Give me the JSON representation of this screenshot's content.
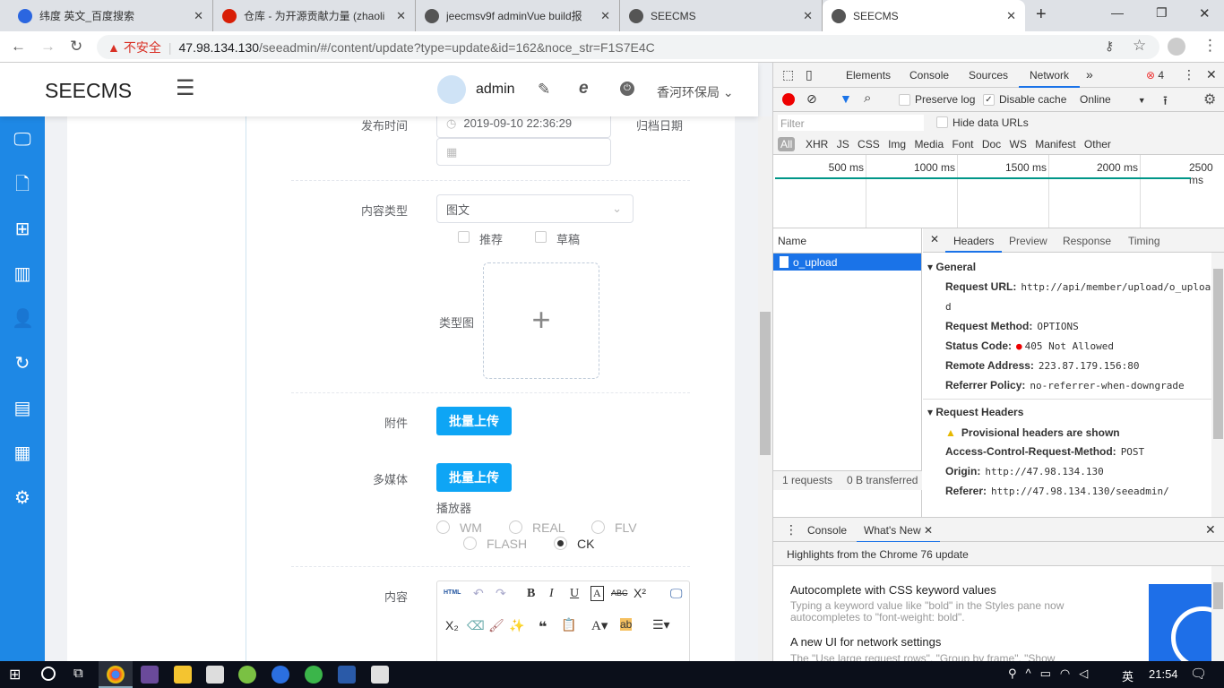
{
  "browser": {
    "tabs": [
      {
        "title": "纬度 英文_百度搜索"
      },
      {
        "title": "仓库 - 为开源贡献力量 (zhaoli"
      },
      {
        "title": "jeecmsv9f adminVue build报"
      },
      {
        "title": "SEECMS"
      },
      {
        "title": "SEECMS"
      }
    ],
    "security_label": "不安全",
    "url_host": "47.98.134.130",
    "url_path": "/seeadmin/#/content/update?type=update&id=162&noce_str=F1S7E4C"
  },
  "app": {
    "logo": "SEECMS",
    "user": "admin",
    "site": "香河环保局"
  },
  "form": {
    "publish_time_label": "发布时间",
    "publish_time": "2019-09-10 22:36:29",
    "archive_label": "归档日期",
    "content_type_label": "内容类型",
    "content_type": "图文",
    "recommend": "推荐",
    "draft": "草稿",
    "type_image_label": "类型图",
    "attachment_label": "附件",
    "upload_btn": "批量上传",
    "media_label": "多媒体",
    "media_upload_btn": "批量上传",
    "player_label": "播放器",
    "players": [
      "WM",
      "REAL",
      "FLV",
      "FLASH",
      "CK"
    ],
    "player_selected": "CK",
    "content_label": "内容",
    "editor_html": "HTML"
  },
  "devtools": {
    "tabs": [
      "Elements",
      "Console",
      "Sources",
      "Network"
    ],
    "active_tab": "Network",
    "error_count": "4",
    "preserve_log": "Preserve log",
    "disable_cache": "Disable cache",
    "throttle": "Online",
    "filter_placeholder": "Filter",
    "hide_data_urls": "Hide data URLs",
    "types": [
      "All",
      "XHR",
      "JS",
      "CSS",
      "Img",
      "Media",
      "Font",
      "Doc",
      "WS",
      "Manifest",
      "Other"
    ],
    "timeline": [
      "500 ms",
      "1000 ms",
      "1500 ms",
      "2000 ms",
      "2500 ms"
    ],
    "name_col": "Name",
    "request": "o_upload",
    "detail_tabs": [
      "Headers",
      "Preview",
      "Response",
      "Timing"
    ],
    "general_title": "General",
    "general": [
      {
        "k": "Request URL:",
        "v": "http://api/member/upload/o_uploa"
      },
      {
        "k": "",
        "v": "d"
      },
      {
        "k": "Request Method:",
        "v": "OPTIONS"
      },
      {
        "k": "Status Code:",
        "v": "405 Not Allowed"
      },
      {
        "k": "Remote Address:",
        "v": "223.87.179.156:80"
      },
      {
        "k": "Referrer Policy:",
        "v": "no-referrer-when-downgrade"
      }
    ],
    "req_headers_title": "Request Headers",
    "provisional": "Provisional headers are shown",
    "req_headers": [
      {
        "k": "Access-Control-Request-Method:",
        "v": "POST"
      },
      {
        "k": "Origin:",
        "v": "http://47.98.134.130"
      },
      {
        "k": "Referer:",
        "v": "http://47.98.134.130/seeadmin/"
      }
    ],
    "requests": "1 requests",
    "transferred": "0 B transferred",
    "drawer_tabs": [
      "Console",
      "What's New"
    ],
    "highlights": "Highlights from the Chrome 76 update",
    "news": [
      {
        "title": "Autocomplete with CSS keyword values",
        "body": "Typing a keyword value like \"bold\" in the Styles pane now autocompletes to \"font-weight: bold\"."
      },
      {
        "title": "A new UI for network settings",
        "body": "The \"Use large request rows\", \"Group by frame\", \"Show"
      }
    ]
  },
  "taskbar": {
    "ime": "英",
    "time": "21:54"
  }
}
